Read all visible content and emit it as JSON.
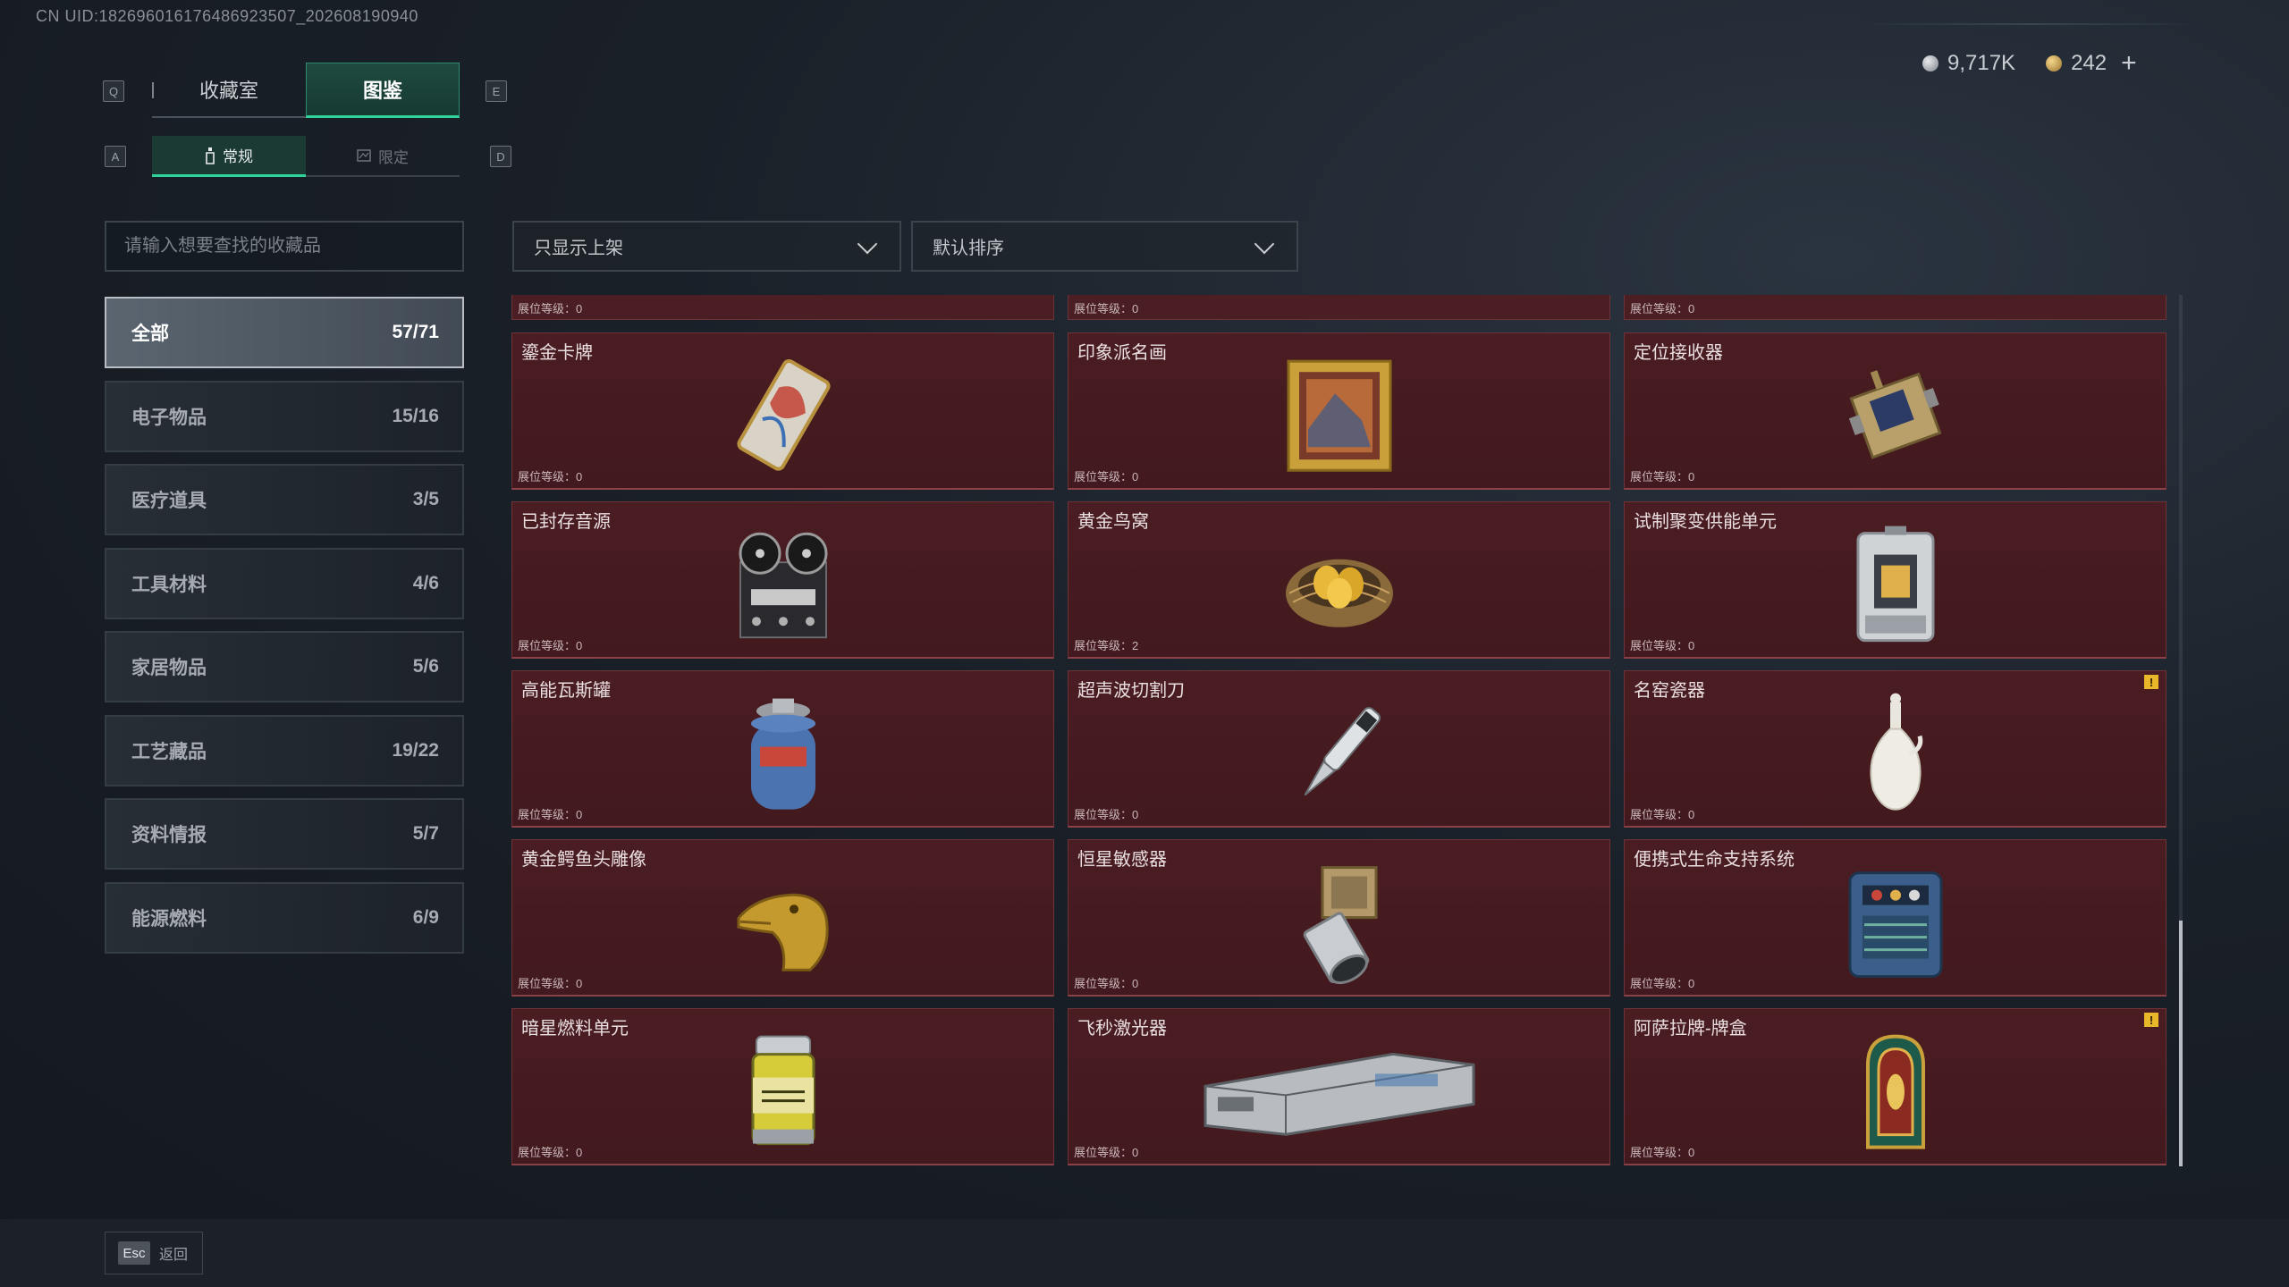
{
  "uid": "CN UID:18269601617648692350​7_202608190940",
  "currency": {
    "silver": "9,717K",
    "gold": "242",
    "plus": "+"
  },
  "keys": {
    "prev_tab": "Q",
    "next_tab": "E",
    "prev_sub": "A",
    "next_sub": "D"
  },
  "main_tabs": [
    {
      "label": "收藏室",
      "active": false
    },
    {
      "label": "图鉴",
      "active": true
    }
  ],
  "sub_tabs": [
    {
      "label": "常规",
      "active": true
    },
    {
      "label": "限定",
      "active": false
    }
  ],
  "search": {
    "placeholder": "请输入想要查找的收藏品",
    "value": ""
  },
  "filters": {
    "shelf": "只显示上架",
    "sort": "默认排序"
  },
  "categories": [
    {
      "label": "全部",
      "count": "57/71",
      "active": true
    },
    {
      "label": "电子物品",
      "count": "15/16"
    },
    {
      "label": "医疗道具",
      "count": "3/5"
    },
    {
      "label": "工具材料",
      "count": "4/6"
    },
    {
      "label": "家居物品",
      "count": "5/6"
    },
    {
      "label": "工艺藏品",
      "count": "19/22"
    },
    {
      "label": "资料情报",
      "count": "5/7"
    },
    {
      "label": "能源燃料",
      "count": "6/9"
    }
  ],
  "partial_row": [
    "展位等级：0",
    "展位等级：0",
    "展位等级：0"
  ],
  "items": [
    {
      "name": "鎏金卡牌",
      "level": "展位等级：0",
      "icon": "gilded-card-icon"
    },
    {
      "name": "印象派名画",
      "level": "展位等级：0",
      "icon": "painting-icon"
    },
    {
      "name": "定位接收器",
      "level": "展位等级：0",
      "icon": "receiver-icon"
    },
    {
      "name": "已封存音源",
      "level": "展位等级：0",
      "icon": "tape-recorder-icon"
    },
    {
      "name": "黄金鸟窝",
      "level": "展位等级：2",
      "icon": "golden-nest-icon"
    },
    {
      "name": "试制聚变供能单元",
      "level": "展位等级：0",
      "icon": "fusion-unit-icon"
    },
    {
      "name": "高能瓦斯罐",
      "level": "展位等级：0",
      "icon": "gas-canister-icon"
    },
    {
      "name": "超声波切割刀",
      "level": "展位等级：0",
      "icon": "ultrasonic-knife-icon"
    },
    {
      "name": "名窑瓷器",
      "level": "展位等级：0",
      "icon": "porcelain-vase-icon",
      "warn": "!"
    },
    {
      "name": "黄金鳄鱼头雕像",
      "level": "展位等级：0",
      "icon": "crocodile-statue-icon"
    },
    {
      "name": "恒星敏感器",
      "level": "展位等级：0",
      "icon": "star-sensor-icon"
    },
    {
      "name": "便携式生命支持系统",
      "level": "展位等级：0",
      "icon": "life-support-icon"
    },
    {
      "name": "暗星燃料单元",
      "level": "展位等级：0",
      "icon": "fuel-cell-icon"
    },
    {
      "name": "飞秒激光器",
      "level": "展位等级：0",
      "icon": "laser-case-icon"
    },
    {
      "name": "阿萨拉牌-牌盒",
      "level": "展位等级：0",
      "icon": "card-box-icon",
      "warn": "!"
    }
  ],
  "footer": {
    "esc_key": "Esc",
    "back_label": "返回"
  },
  "colors": {
    "accent": "#31d39d",
    "card_bg": "#4a1d22",
    "warn": "#e8b82a"
  }
}
